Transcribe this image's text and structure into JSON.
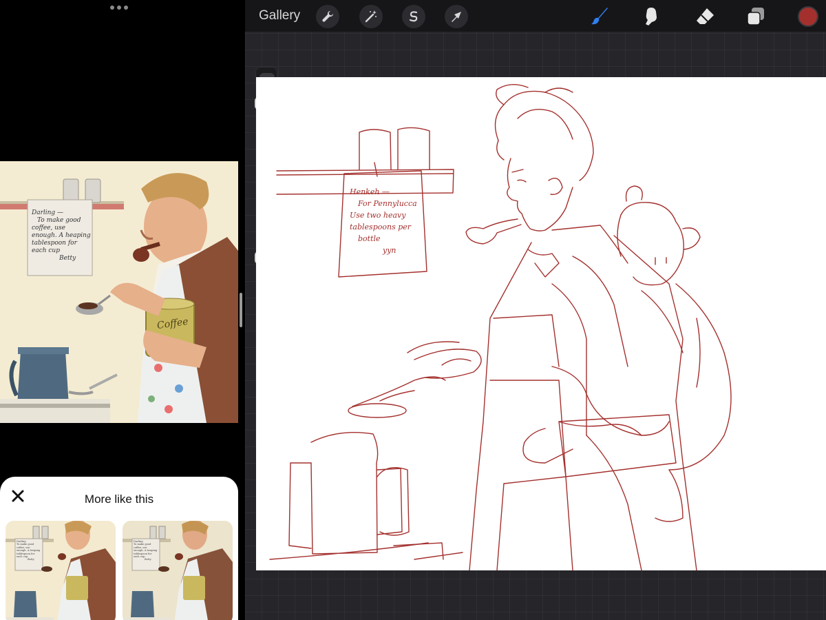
{
  "toolbar": {
    "gallery_label": "Gallery",
    "left_tools": [
      "wrench-icon",
      "magic-wand-icon",
      "selection-icon",
      "transform-arrow-icon"
    ],
    "right_tools": [
      "brush-icon",
      "smudge-icon",
      "eraser-icon",
      "layers-icon"
    ],
    "active_tool": "brush-icon",
    "accent_color": "#2f7ff2",
    "current_color": "#a3302d"
  },
  "sidebar": {
    "brush_size_level": 0.78,
    "opacity_level": 0.97,
    "controls": [
      "modify-button",
      "undo-button",
      "redo-button"
    ]
  },
  "reference": {
    "note_lines": [
      "Darling —",
      "To make good",
      "coffee, use",
      "enough. A heaping",
      "tablespoon for",
      "each cup",
      "Betty"
    ],
    "can_label": "Coffee"
  },
  "sketch": {
    "note_lines": [
      "Henkeh —",
      "For Pennylucca",
      "Use two heavy",
      "tablespoons per",
      "bottle",
      "yyn"
    ],
    "stroke_color": "#a3302d"
  },
  "more_like_this": {
    "title": "More like this",
    "items": [
      {
        "note_lines": [
          "Darling",
          "To make good",
          "coffee, use",
          "enough. A heaping",
          "tablespoon for",
          "each cup",
          "Betty"
        ]
      },
      {
        "note_lines": [
          "Darling",
          "To make good",
          "coffee, use",
          "enough. A heaping",
          "tablespoon for",
          "each cup",
          "Betty"
        ]
      }
    ]
  }
}
